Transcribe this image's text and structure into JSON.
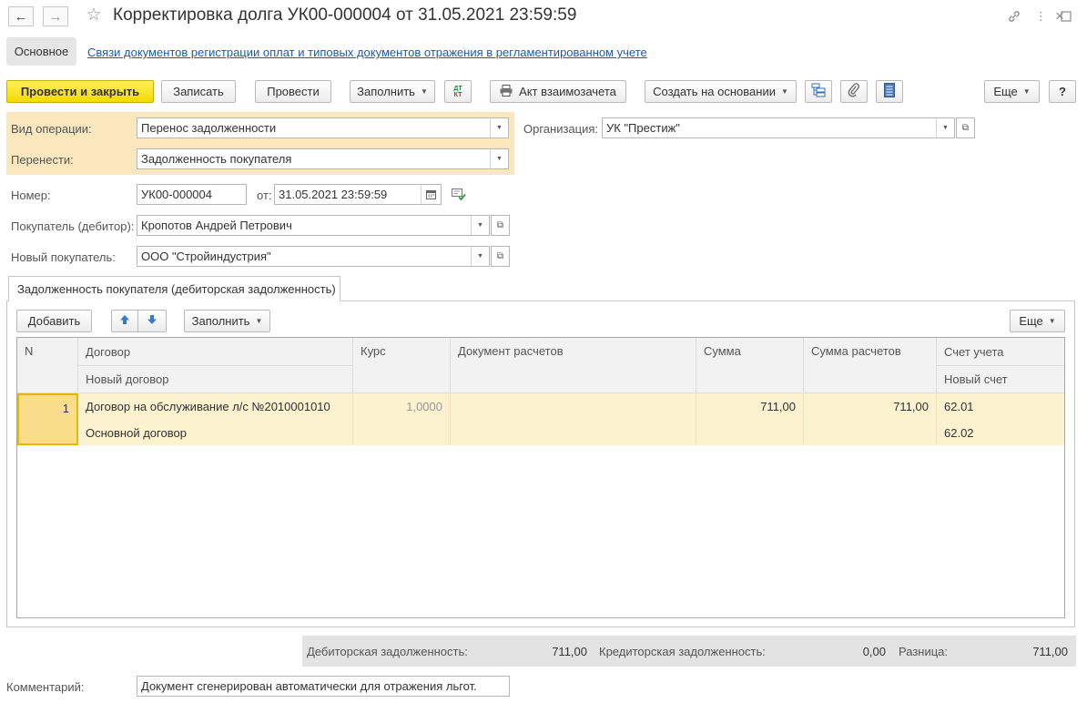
{
  "window": {
    "title": "Корректировка долга УК00-000004 от 31.05.2021 23:59:59"
  },
  "sections": {
    "main": "Основное",
    "link": "Связи документов регистрации оплат и типовых документов отражения в регламентированном учете"
  },
  "toolbar": {
    "post_close": "Провести и закрыть",
    "save": "Записать",
    "post": "Провести",
    "fill": "Заполнить",
    "dtkt_top": "ДТ",
    "dtkt_bottom": "КТ",
    "act": "Акт взаимозачета",
    "create_based": "Создать на основании",
    "more": "Еще",
    "help": "?"
  },
  "form": {
    "operation_label": "Вид операции:",
    "operation_value": "Перенос задолженности",
    "transfer_label": "Перенести:",
    "transfer_value": "Задолженность покупателя",
    "org_label": "Организация:",
    "org_value": "УК \"Престиж\"",
    "number_label": "Номер:",
    "number_value": "УК00-000004",
    "date_label": "от:",
    "date_value": "31.05.2021 23:59:59",
    "buyer_label": "Покупатель (дебитор):",
    "buyer_value": "Кропотов Андрей Петрович",
    "new_buyer_label": "Новый покупатель:",
    "new_buyer_value": "ООО \"Стройиндустрия\""
  },
  "tab": {
    "label": "Задолженность покупателя (дебиторская задолженность)",
    "add": "Добавить",
    "fill": "Заполнить",
    "more": "Еще"
  },
  "table": {
    "headers": {
      "n": "N",
      "contract": "Договор",
      "new_contract": "Новый договор",
      "rate": "Курс",
      "doc": "Документ расчетов",
      "sum": "Сумма",
      "sum_calc": "Сумма расчетов",
      "account": "Счет учета",
      "new_account": "Новый счет"
    },
    "rows": [
      {
        "n": "1",
        "contract": "Договор на обслуживание л/с №2010001010",
        "new_contract": "Основной договор",
        "rate": "1,0000",
        "doc": "",
        "sum": "711,00",
        "sum_calc": "711,00",
        "account": "62.01",
        "new_account": "62.02"
      }
    ]
  },
  "totals": {
    "debit_label": "Дебиторская задолженность:",
    "debit_value": "711,00",
    "credit_label": "Кредиторская задолженность:",
    "credit_value": "0,00",
    "diff_label": "Разница:",
    "diff_value": "711,00"
  },
  "comment": {
    "label": "Комментарий:",
    "value": "Документ сгенерирован автоматически для отражения льгот."
  },
  "colors": {
    "primary_button": "#f5da00",
    "highlight": "#fbe7bd",
    "row_selected": "#fcf2d0",
    "link": "#2457a7"
  }
}
